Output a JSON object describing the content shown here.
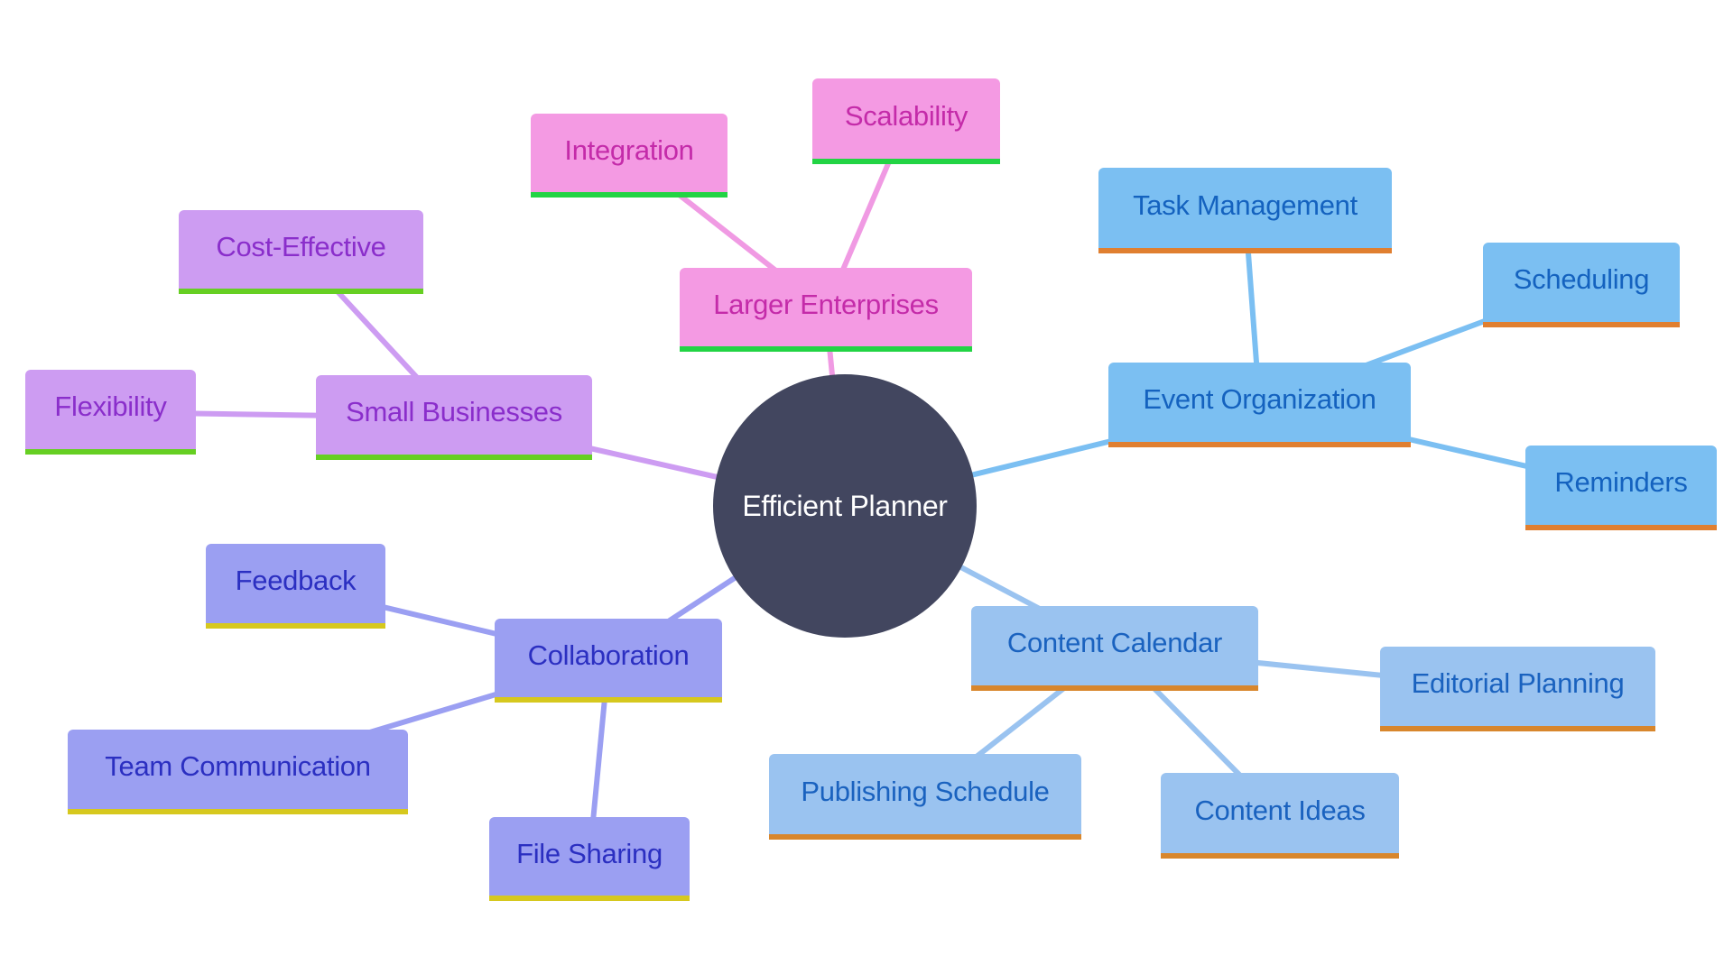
{
  "diagram": {
    "type": "mindmap",
    "root": {
      "id": "root",
      "label": "Efficient Planner",
      "color": "#42465f",
      "text_color": "#ffffff"
    },
    "branches": [
      {
        "id": "larger-enterprises",
        "label": "Larger Enterprises",
        "style": {
          "fill": "#f49ae3",
          "text": "#c42ba9",
          "border": "#22d444",
          "edge": "#f09ae3"
        },
        "children": [
          {
            "id": "integration",
            "label": "Integration"
          },
          {
            "id": "scalability",
            "label": "Scalability"
          }
        ]
      },
      {
        "id": "small-businesses",
        "label": "Small Businesses",
        "style": {
          "fill": "#cd9cf2",
          "text": "#8a2ecb",
          "border": "#66cf22",
          "edge": "#cd9cf2"
        },
        "children": [
          {
            "id": "cost-effective",
            "label": "Cost-Effective"
          },
          {
            "id": "flexibility",
            "label": "Flexibility"
          }
        ]
      },
      {
        "id": "event-organization",
        "label": "Event Organization",
        "style": {
          "fill": "#7bbff2",
          "text": "#1462bf",
          "border": "#e07f30",
          "edge": "#7bbff2"
        },
        "children": [
          {
            "id": "task-management",
            "label": "Task Management"
          },
          {
            "id": "scheduling",
            "label": "Scheduling"
          },
          {
            "id": "reminders",
            "label": "Reminders"
          }
        ]
      },
      {
        "id": "content-calendar",
        "label": "Content Calendar",
        "style": {
          "fill": "#9ac3f0",
          "text": "#1a62bf",
          "border": "#d8862c",
          "edge": "#9ac3f0"
        },
        "children": [
          {
            "id": "editorial-planning",
            "label": "Editorial Planning"
          },
          {
            "id": "publishing-schedule",
            "label": "Publishing Schedule"
          },
          {
            "id": "content-ideas",
            "label": "Content Ideas"
          }
        ]
      },
      {
        "id": "collaboration",
        "label": "Collaboration",
        "style": {
          "fill": "#9b9ff2",
          "text": "#2b2fc1",
          "border": "#d6c81e",
          "edge": "#9b9ff2"
        },
        "children": [
          {
            "id": "feedback",
            "label": "Feedback"
          },
          {
            "id": "team-communication",
            "label": "Team Communication"
          },
          {
            "id": "file-sharing",
            "label": "File Sharing"
          }
        ]
      }
    ]
  }
}
